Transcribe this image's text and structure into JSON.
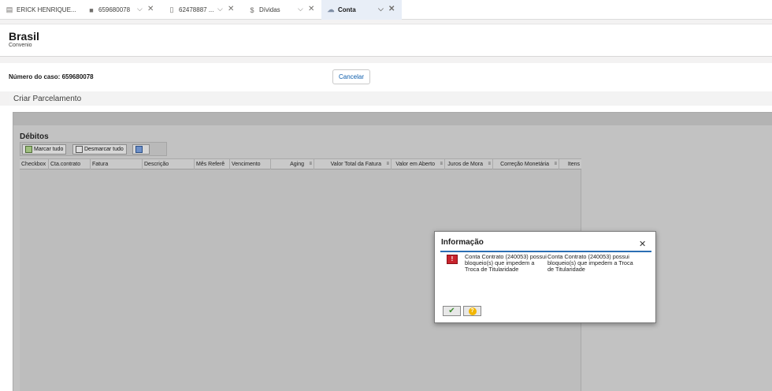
{
  "tabs": [
    {
      "label": "ERICK HENRIQUE...",
      "icon": "contact-icon",
      "active": false
    },
    {
      "label": "659680078",
      "icon": "briefcase-icon",
      "active": false
    },
    {
      "label": "62478887 ...",
      "icon": "document-icon",
      "active": false
    },
    {
      "label": "Dívidas",
      "icon": "money-icon",
      "active": false
    },
    {
      "label": "Conta",
      "icon": "cloud-icon",
      "active": true
    }
  ],
  "header": {
    "title": "Brasil",
    "subtitle": "Convenio"
  },
  "case": {
    "label": "Número do caso: 659680078",
    "cancel_label": "Cancelar"
  },
  "section": {
    "title": "Criar Parcelamento"
  },
  "debitos": {
    "title": "Débitos",
    "toolbar": {
      "mark_all": "Marcar tudo",
      "unmark_all": "Desmarcar tudo"
    },
    "columns": [
      "Checkbox",
      "Cta.contrato",
      "Fatura",
      "Descrição",
      "Mês Referê",
      "Vencimento",
      "Aging",
      "Valor Total da Fatura",
      "Valor em Aberto",
      "Juros de Mora",
      "Correção Monetária",
      "Itens"
    ]
  },
  "dialog": {
    "title": "Informação",
    "message_1": "Conta Contrato (240053) possui bloqueio(s) que impedem a Troca de Titularidade",
    "message_2": "Conta Contrato (240053) possui bloqueio(s) que impedem a Troca de Titularidade",
    "ok_icon": "check-icon",
    "help_icon": "help-icon"
  },
  "colors": {
    "active_tab_bg": "#e8eef7",
    "dialog_rule": "#2b6fb3",
    "error_icon": "#c8232c",
    "link": "#0b5cab"
  }
}
